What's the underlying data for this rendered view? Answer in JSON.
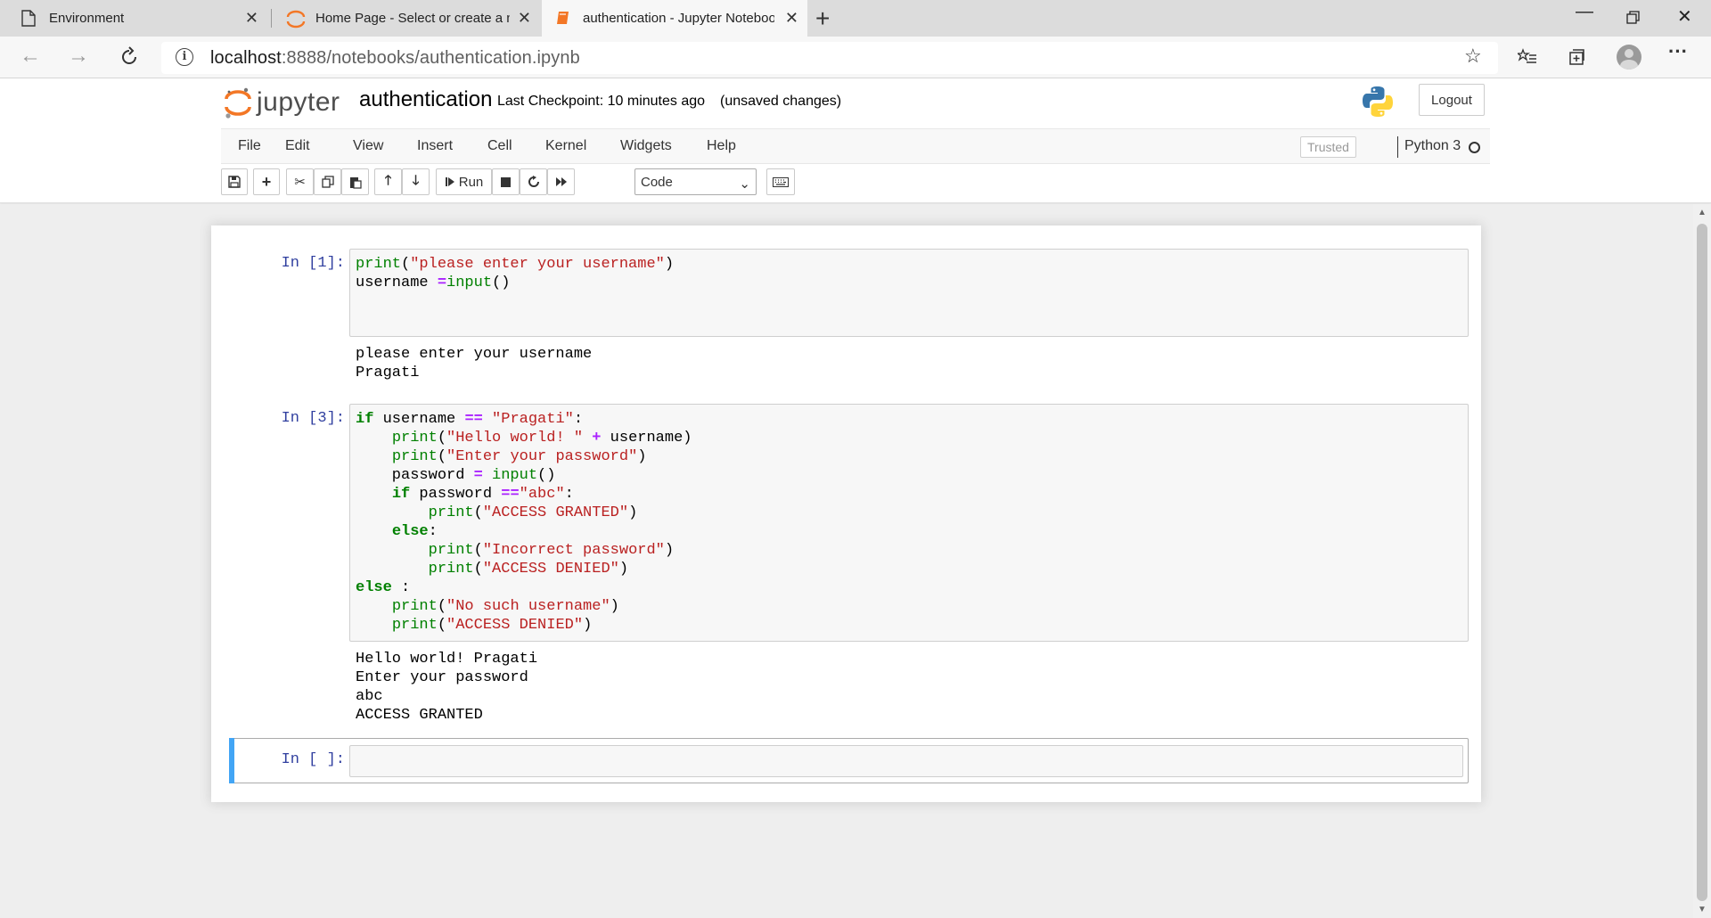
{
  "browser": {
    "tabs": [
      {
        "title": "Environment",
        "icon": "page-icon"
      },
      {
        "title": "Home Page - Select or create a notebook",
        "icon": "jupyter-icon"
      },
      {
        "title": "authentication - Jupyter Notebook",
        "icon": "notebook-icon",
        "active": true
      }
    ],
    "url_host": "localhost",
    "url_path": ":8888/notebooks/authentication.ipynb"
  },
  "header": {
    "logo_text": "jupyter",
    "notebook_name": "authentication",
    "checkpoint": "Last Checkpoint: 10 minutes ago",
    "unsaved": "(unsaved changes)",
    "logout_label": "Logout"
  },
  "menu": {
    "items": [
      "File",
      "Edit",
      "View",
      "Insert",
      "Cell",
      "Kernel",
      "Widgets",
      "Help"
    ],
    "trusted_label": "Trusted",
    "kernel_name": "Python 3"
  },
  "toolbar": {
    "run_label": "Run",
    "cell_type": "Code"
  },
  "cells": [
    {
      "prompt": "In [1]:",
      "output": "please enter your username\nPragati"
    },
    {
      "prompt": "In [3]:",
      "output": "Hello world! Pragati\nEnter your password\nabc\nACCESS GRANTED"
    },
    {
      "prompt": "In [ ]:"
    }
  ],
  "colors": {
    "accent": "#42A5F5",
    "prompt": "#303F9F",
    "keyword": "#008000",
    "string": "#BA2121",
    "operator": "#AA22FF",
    "jupyter_orange": "#F37726"
  }
}
